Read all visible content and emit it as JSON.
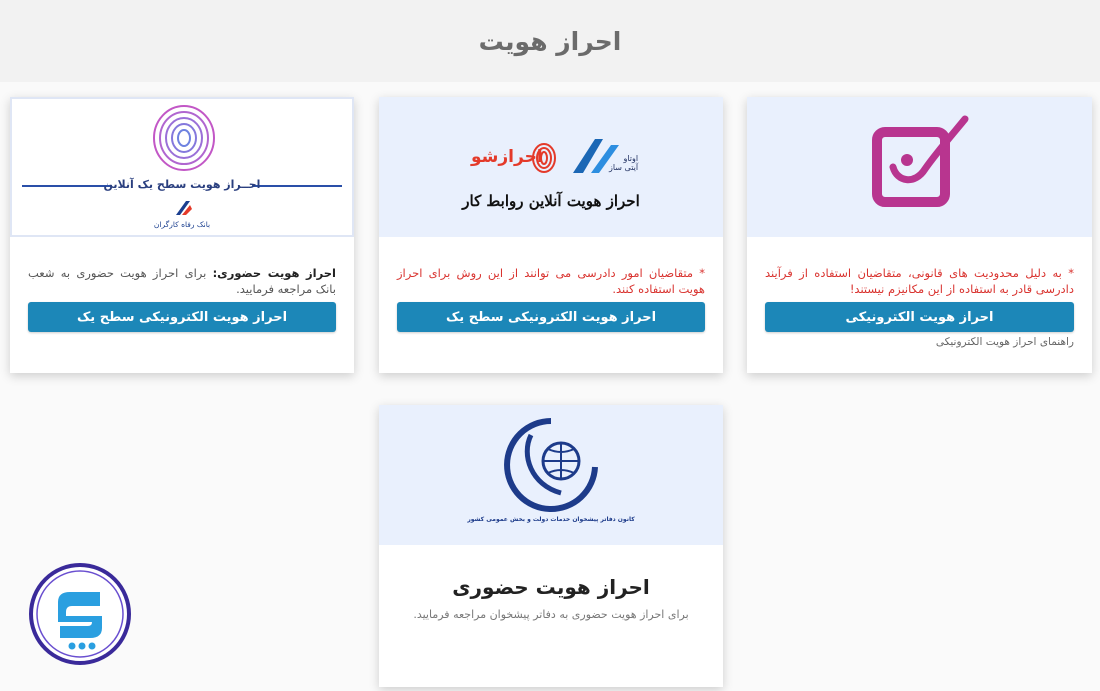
{
  "header": {
    "title": "احراز هویت"
  },
  "cards": {
    "electronic": {
      "warning": "* به دلیل محدودیت های قانونی، متقاضیان استفاده از فرآیند دادرسی قادر به استفاده از این مکانیزم نیستند!",
      "button": "احراز هویت الکترونیکی",
      "help_link": "راهنمای احراز هویت الکترونیکی"
    },
    "level_one": {
      "banner": {
        "brand_a": "احرازشو",
        "brand_b_line1": "اوتاو",
        "brand_b_line2": "آیتی ساز",
        "caption": "احراز هویت آنلاین روابط کار"
      },
      "warning": "* متقاضیان امور دادرسی می توانند از این روش برای احراز هویت استفاده کنند.",
      "button": "احراز هویت الکترونیکی سطح یک"
    },
    "in_person_bank": {
      "banner": {
        "caption": "احــراز هویت سطح یک آنلاین",
        "bank_name": "بانک رفاه کارگران"
      },
      "desc_bold": "احراز هویت حضوری:",
      "desc_text": " برای احراز هویت حضوری به شعب بانک مراجعه فرمایید.",
      "button": "احراز هویت الکترونیکی سطح یک"
    },
    "in_person_office": {
      "banner": {
        "caption": "کانون دفاتر پیشخوان خدمات دولت و بخش عمومی کشور"
      },
      "title": "احراز هویت حضوری",
      "subtitle": "برای احراز هویت حضوری به دفاتر پیشخوان مراجعه فرمایید."
    }
  },
  "colors": {
    "button": "#1c87b8",
    "warning": "#d9332f",
    "banner_bg": "#e9f0fd",
    "brand_magenta": "#b8358f"
  }
}
